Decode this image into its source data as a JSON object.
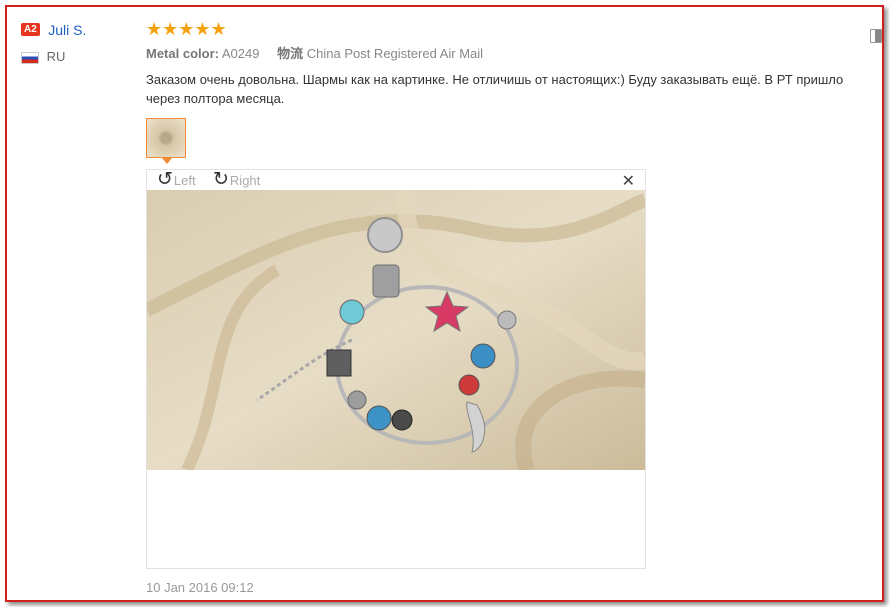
{
  "review": {
    "user": {
      "badge": "A2",
      "name": "Juli S.",
      "country": "RU"
    },
    "rating": 5,
    "stars": "★★★★★",
    "metal_label": "Metal color:",
    "metal_value": "A0249",
    "shipping_label": "物流",
    "shipping_value": "China Post Registered Air Mail",
    "text_line1": "Заказом очень довольна. Шармы как на картинке. Не отличишь от настоящих:) Буду заказывать ещё. В РТ пришло",
    "text_line2": "через полтора месяца.",
    "date": "10 Jan 2016 09:12"
  },
  "viewer": {
    "rotate_left": "Left",
    "rotate_right": "Right",
    "close": "✕"
  },
  "colors": {
    "frame": "#d0201e",
    "star": "#f6a10e",
    "name": "#1f5fbf",
    "badge": "#e8351f"
  }
}
